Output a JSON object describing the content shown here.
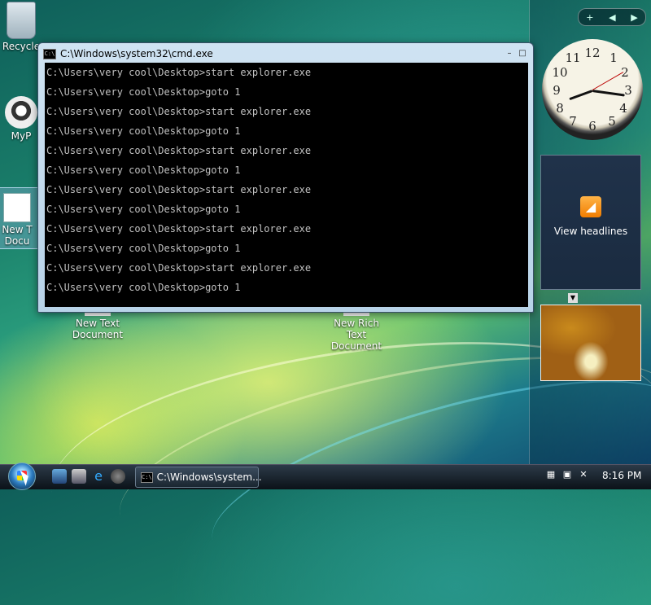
{
  "desktop": {
    "icons": [
      {
        "label": "Recycle"
      },
      {
        "label": "MyP"
      },
      {
        "label": "New T Docu"
      },
      {
        "label": "New Text Document"
      },
      {
        "label": "New Rich Text Document"
      }
    ]
  },
  "cmd": {
    "title": "C:\\Windows\\system32\\cmd.exe",
    "icon_text": "C:\\",
    "lines": [
      "C:\\Users\\very cool\\Desktop>start explorer.exe",
      "C:\\Users\\very cool\\Desktop>goto 1",
      "C:\\Users\\very cool\\Desktop>start explorer.exe",
      "C:\\Users\\very cool\\Desktop>goto 1",
      "C:\\Users\\very cool\\Desktop>start explorer.exe",
      "C:\\Users\\very cool\\Desktop>goto 1",
      "C:\\Users\\very cool\\Desktop>start explorer.exe",
      "C:\\Users\\very cool\\Desktop>goto 1",
      "C:\\Users\\very cool\\Desktop>start explorer.exe",
      "C:\\Users\\very cool\\Desktop>goto 1",
      "C:\\Users\\very cool\\Desktop>start explorer.exe",
      "C:\\Users\\very cool\\Desktop>goto 1"
    ]
  },
  "sidebar": {
    "add_label": "+",
    "prev_label": "◀",
    "next_label": "▶",
    "clock_numbers": [
      "12",
      "1",
      "2",
      "3",
      "4",
      "5",
      "6",
      "7",
      "8",
      "9",
      "10",
      "11"
    ],
    "feed_label": "View headlines"
  },
  "taskbar": {
    "task_label": "C:\\Windows\\system...",
    "task_icon_text": "C:\\",
    "time": "8:16 PM"
  }
}
